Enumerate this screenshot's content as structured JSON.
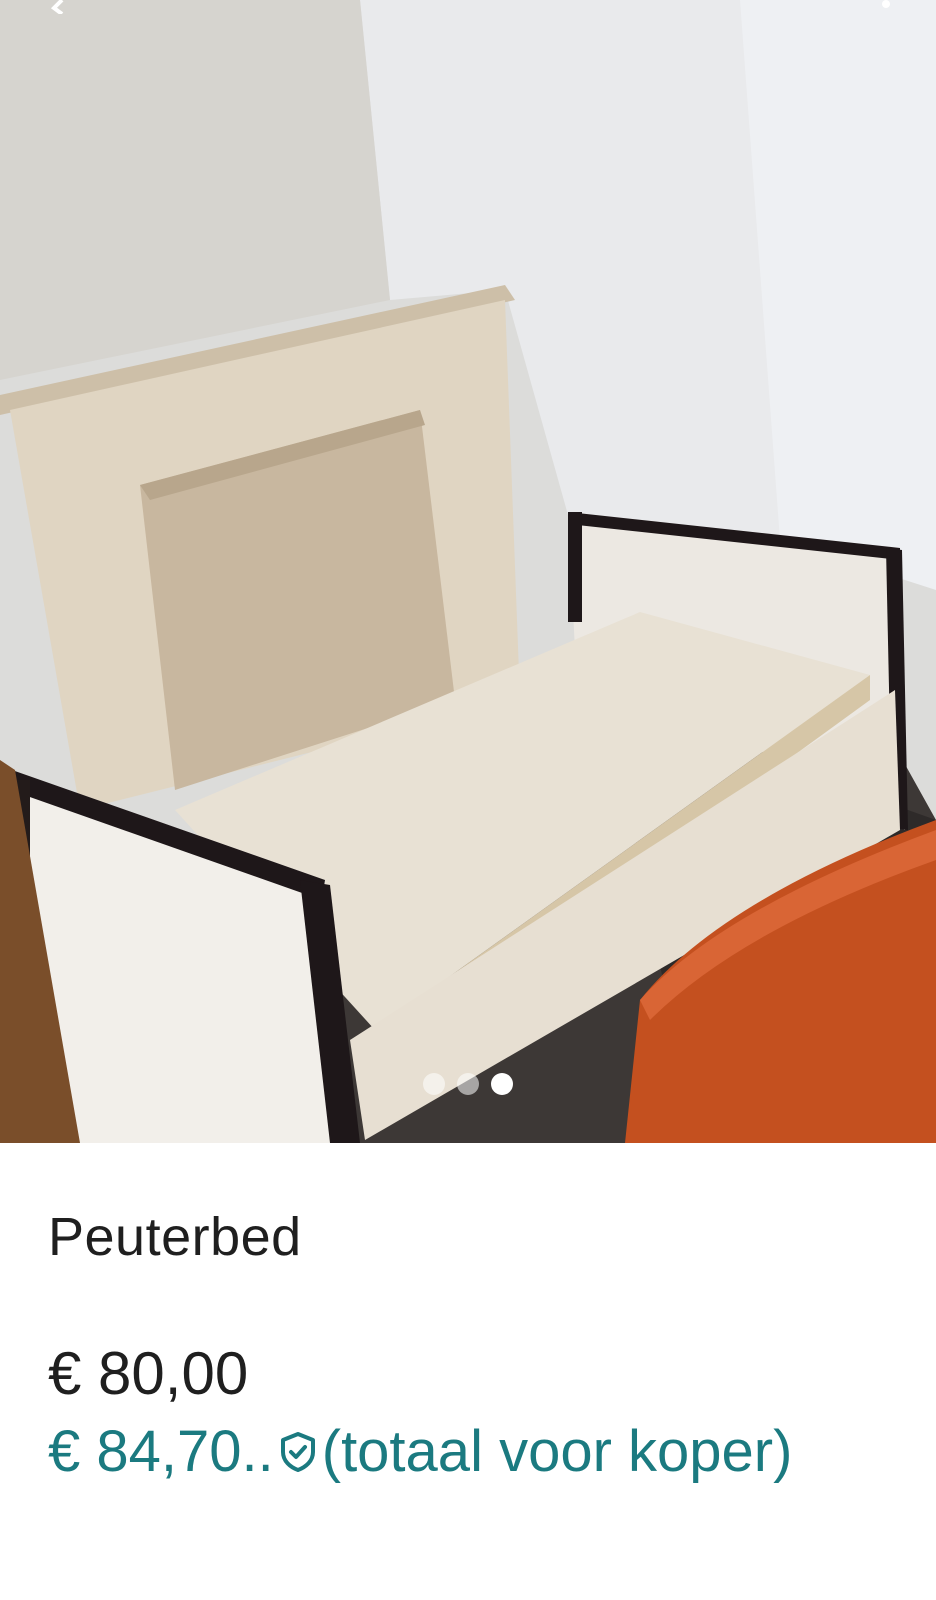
{
  "colors": {
    "accent": "#1b7a80",
    "text_primary": "#1f1f1f",
    "background": "#ffffff",
    "dot_inactive": "#ffffff8c",
    "dot_active": "#ffffff"
  },
  "gallery": {
    "image_description_icon": "photo",
    "current_index": 3,
    "total_images": 3,
    "top_left_icon": "back-arrow-icon",
    "top_right_icon": "more-options-icon"
  },
  "listing": {
    "title": "Peuterbed",
    "price": "€ 80,00",
    "buyer_total_amount": "€ 84,70..",
    "buyer_total_icon": "shield-check-icon",
    "buyer_total_label": "(totaal voor koper)"
  }
}
